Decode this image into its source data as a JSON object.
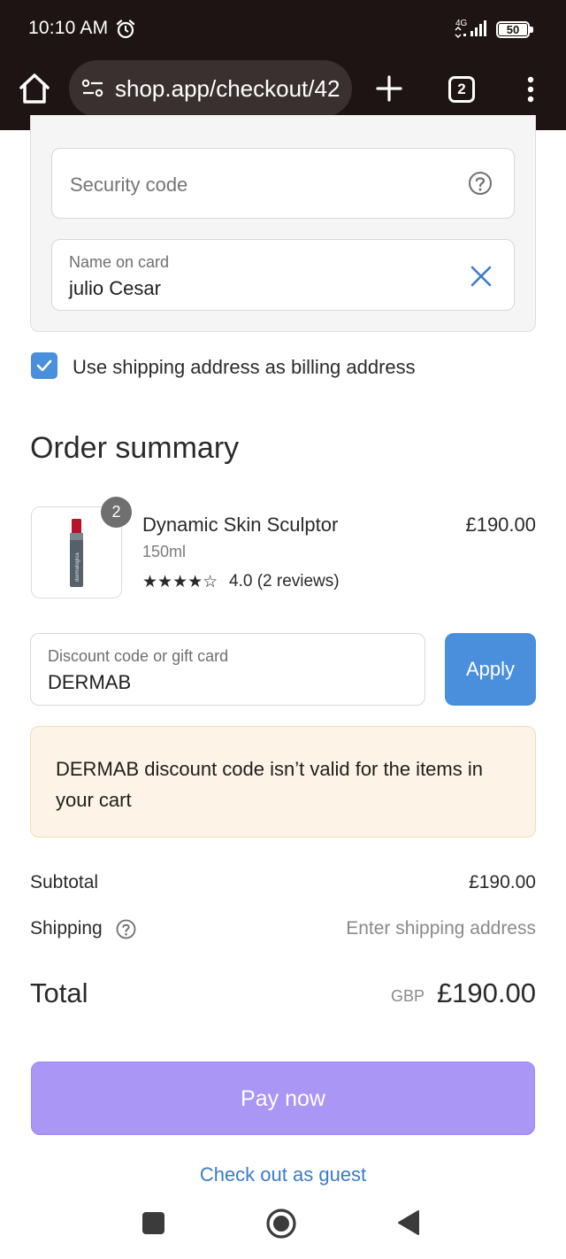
{
  "status_bar": {
    "time": "10:10 AM",
    "network": "4G",
    "battery": "50"
  },
  "browser": {
    "url": "shop.app/checkout/42",
    "tab_count": "2"
  },
  "payment": {
    "security_code_placeholder": "Security code",
    "name_label": "Name on card",
    "name_value": "julio Cesar",
    "billing_same_label": "Use shipping address as billing address"
  },
  "summary": {
    "title": "Order summary",
    "item": {
      "quantity": "2",
      "name": "Dynamic Skin Sculptor",
      "size": "150ml",
      "stars": "★★★★☆",
      "rating_text": "4.0 (2 reviews)",
      "price": "£190.00",
      "brand": "dermalogica"
    },
    "discount_label": "Discount code or gift card",
    "discount_value": "DERMAB",
    "apply_label": "Apply",
    "error_message": "DERMAB discount code isn’t valid for the items in your cart",
    "subtotal_label": "Subtotal",
    "subtotal_value": "£190.00",
    "shipping_label": "Shipping",
    "shipping_value": "Enter shipping address",
    "total_label": "Total",
    "total_currency": "GBP",
    "total_value": "£190.00"
  },
  "actions": {
    "pay_label": "Pay now",
    "guest_label": "Check out as guest"
  },
  "colors": {
    "accent_blue": "#4a8fdc",
    "pay_purple": "#a996f5",
    "alert_bg": "#fdf3e6",
    "topbar": "#1d1413"
  }
}
